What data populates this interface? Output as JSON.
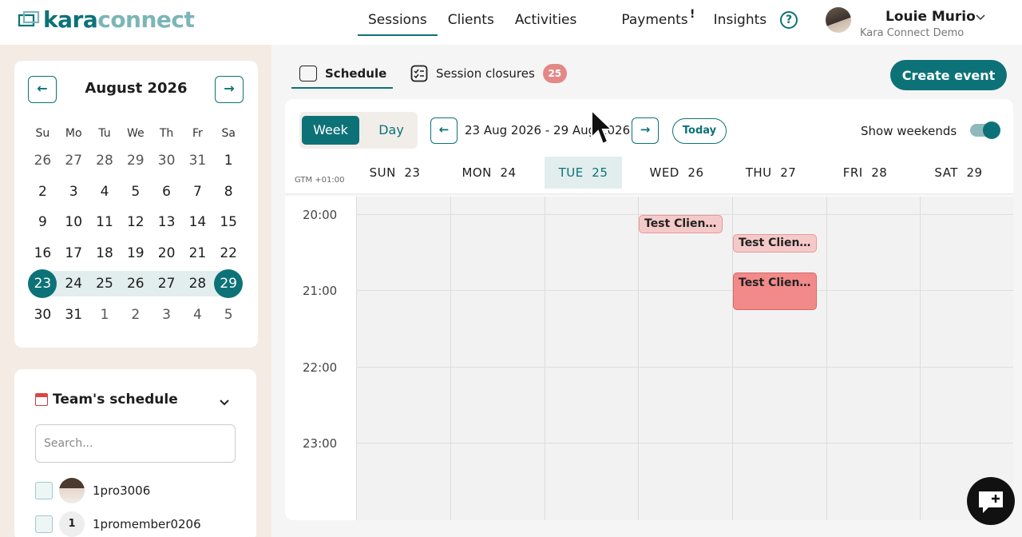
{
  "brand": {
    "name_prefix": "kara",
    "name_suffix": "connect"
  },
  "nav": {
    "items": [
      {
        "label": "Sessions",
        "active": true
      },
      {
        "label": "Clients",
        "active": false
      },
      {
        "label": "Activities",
        "active": false
      },
      {
        "label": "Payments",
        "active": false
      },
      {
        "label": "Insights",
        "active": false
      }
    ],
    "payments_alert": "!",
    "help_icon": "question-circle-icon"
  },
  "user": {
    "name": "Louie Murio",
    "org": "Kara Connect Demo"
  },
  "calendar": {
    "month_label": "August 2026",
    "prev_icon": "←",
    "next_icon": "→",
    "weekdays": [
      "Su",
      "Mo",
      "Tu",
      "We",
      "Th",
      "Fr",
      "Sa"
    ],
    "weeks": [
      [
        "26",
        "27",
        "28",
        "29",
        "30",
        "31",
        "1"
      ],
      [
        "2",
        "3",
        "4",
        "5",
        "6",
        "7",
        "8"
      ],
      [
        "9",
        "10",
        "11",
        "12",
        "13",
        "14",
        "15"
      ],
      [
        "16",
        "17",
        "18",
        "19",
        "20",
        "21",
        "22"
      ],
      [
        "23",
        "24",
        "25",
        "26",
        "27",
        "28",
        "29"
      ],
      [
        "30",
        "31",
        "1",
        "2",
        "3",
        "4",
        "5"
      ]
    ],
    "selected_range": {
      "start": "23",
      "end": "29"
    }
  },
  "team": {
    "title": "Team's schedule",
    "search_placeholder": "Search...",
    "members": [
      {
        "name": "1pro3006",
        "avatar": "photo"
      },
      {
        "name": "1promember0206",
        "avatar": "1"
      }
    ]
  },
  "tabs": {
    "schedule": "Schedule",
    "closures": "Session closures",
    "closures_count": "25"
  },
  "create_event_label": "Create event",
  "toolbar": {
    "week": "Week",
    "day": "Day",
    "prev": "←",
    "next": "→",
    "date_range": "23 Aug 2026 - 29 Aug 2026",
    "today": "Today",
    "show_weekends": "Show weekends",
    "weekends_on": true
  },
  "week": {
    "timezone": "GTM +01:00",
    "days": [
      {
        "name": "SUN",
        "num": "23"
      },
      {
        "name": "MON",
        "num": "24"
      },
      {
        "name": "TUE",
        "num": "25",
        "today": true
      },
      {
        "name": "WED",
        "num": "26"
      },
      {
        "name": "THU",
        "num": "27"
      },
      {
        "name": "FRI",
        "num": "28"
      },
      {
        "name": "SAT",
        "num": "29"
      }
    ],
    "times": [
      "20:00",
      "21:00",
      "22:00",
      "23:00"
    ]
  },
  "events": [
    {
      "title": "Test Client...",
      "day": "WED",
      "start": "20:00",
      "end": "20:15",
      "style": "light"
    },
    {
      "title": "Test Client...",
      "day": "THU",
      "start": "20:15",
      "end": "20:30",
      "style": "light"
    },
    {
      "title": "Test Client...",
      "day": "THU",
      "start": "20:45",
      "end": "21:15",
      "style": "strong"
    }
  ],
  "colors": {
    "accent": "#0d7278",
    "event_light": "#f6c9c9",
    "event_strong": "#f28a8a",
    "badge": "#e48787"
  }
}
